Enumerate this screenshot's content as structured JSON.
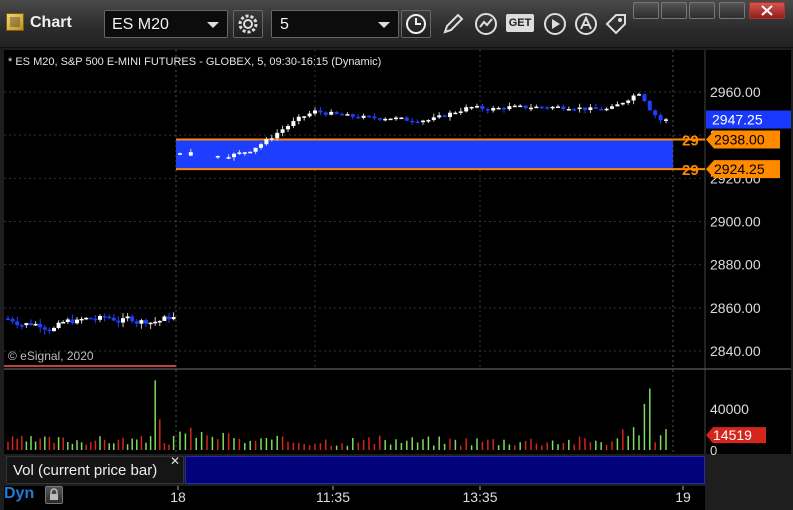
{
  "window": {
    "title": "Chart"
  },
  "toolbar": {
    "symbol": "ES M20",
    "interval": "5",
    "icons": [
      "settings-icon",
      "clock-icon",
      "pencil-icon",
      "study-icon",
      "get-icon",
      "play-icon",
      "alert-icon",
      "tag-icon"
    ],
    "get_label": "GET"
  },
  "chart": {
    "description": "* ES M20, S&P 500 E-MINI FUTURES - GLOBEX, 5, 09:30-16:15 (Dynamic)",
    "credit": "© eSignal, 2020",
    "price_axis": [
      "2960.00",
      "2940.00",
      "2920.00",
      "2900.00",
      "2880.00",
      "2860.00",
      "2840.00"
    ],
    "last_price": "2947.25",
    "zone_high": "2938.00",
    "zone_low": "2924.25",
    "zone_high_partial": "29",
    "zone_low_partial": "29",
    "time_axis": [
      "18",
      "11:35",
      "13:35",
      "19"
    ],
    "colors": {
      "up": "#ffffff",
      "down": "#1f3fff",
      "zone_fill": "#1e3eff",
      "zone_line": "#ff8a00",
      "last_price_bg": "#1a39ff",
      "vol_up": "#7dde5a",
      "vol_down": "#d4261c"
    }
  },
  "volume": {
    "label": "Vol (current price bar)",
    "axis": [
      "40000",
      "0"
    ],
    "current": "14519"
  },
  "status": {
    "mode": "Dyn"
  }
}
